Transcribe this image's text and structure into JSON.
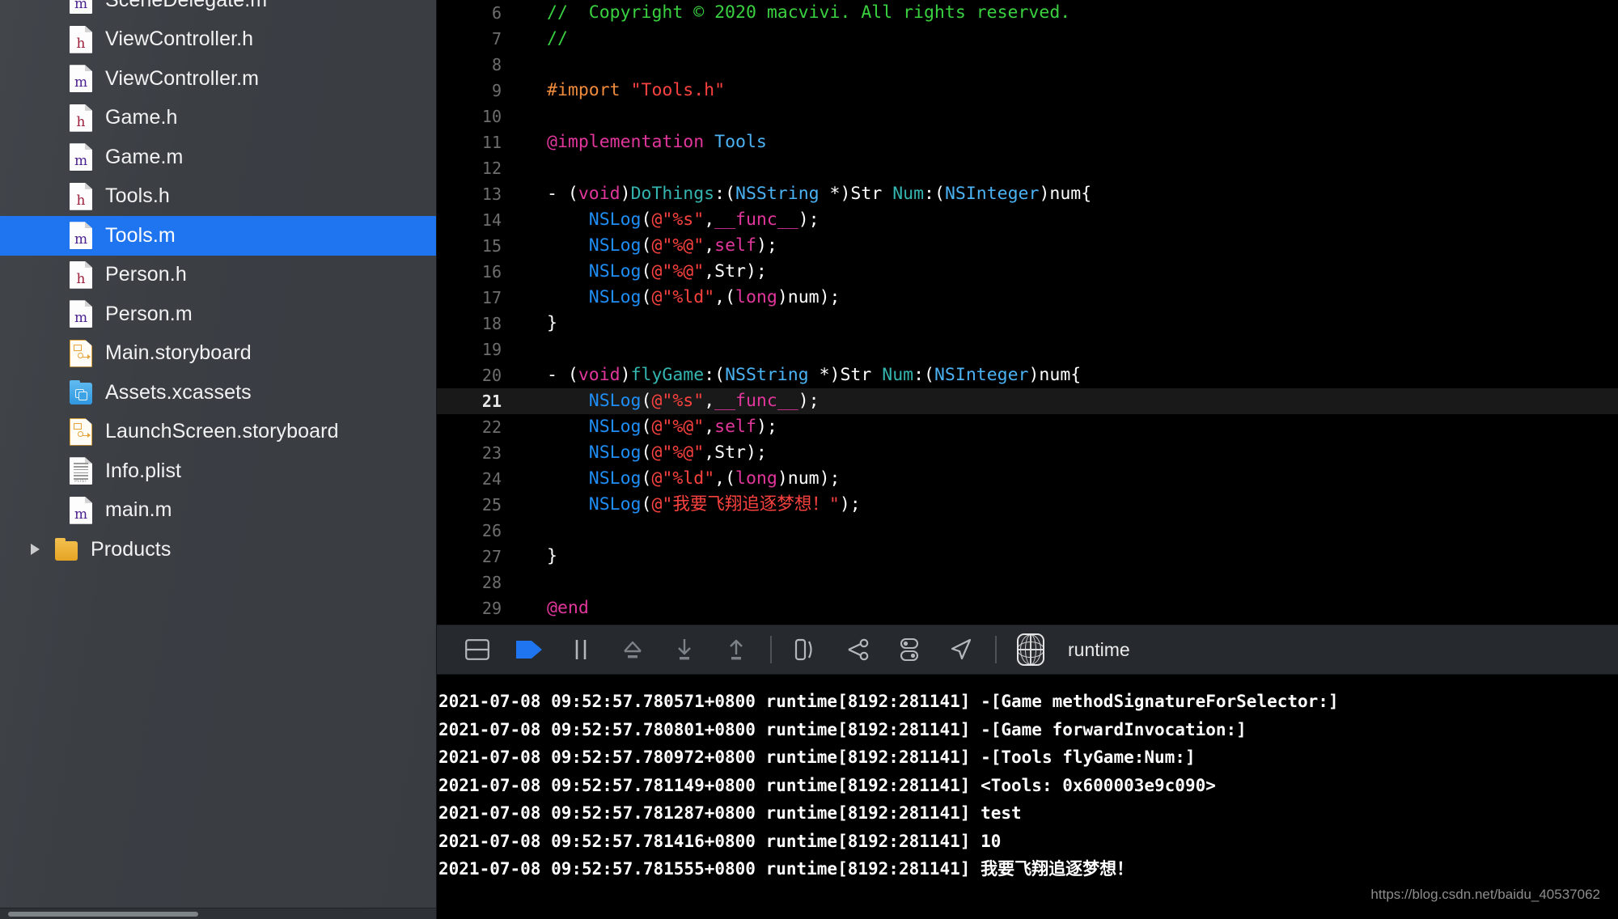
{
  "sidebar": {
    "name": "project-navigator",
    "selected_file": "Tools.m",
    "items": [
      {
        "label": "SceneDelegate.m",
        "icon": "objc-m-file-icon",
        "kind": "m",
        "selected": false,
        "partial": false
      },
      {
        "label": "ViewController.h",
        "icon": "objc-h-file-icon",
        "kind": "h",
        "selected": false,
        "partial": false
      },
      {
        "label": "ViewController.m",
        "icon": "objc-m-file-icon",
        "kind": "m",
        "selected": false,
        "partial": false
      },
      {
        "label": "Game.h",
        "icon": "objc-h-file-icon",
        "kind": "h",
        "selected": false,
        "partial": false
      },
      {
        "label": "Game.m",
        "icon": "objc-m-file-icon",
        "kind": "m",
        "selected": false,
        "partial": false
      },
      {
        "label": "Tools.h",
        "icon": "objc-h-file-icon",
        "kind": "h",
        "selected": false,
        "partial": false
      },
      {
        "label": "Tools.m",
        "icon": "objc-m-file-icon",
        "kind": "m",
        "selected": true,
        "partial": false
      },
      {
        "label": "Person.h",
        "icon": "objc-h-file-icon",
        "kind": "h",
        "selected": false,
        "partial": false
      },
      {
        "label": "Person.m",
        "icon": "objc-m-file-icon",
        "kind": "m",
        "selected": false,
        "partial": false
      },
      {
        "label": "Main.storyboard",
        "icon": "storyboard-file-icon",
        "kind": "sb",
        "selected": false,
        "partial": false
      },
      {
        "label": "Assets.xcassets",
        "icon": "xcassets-folder-icon",
        "kind": "xc",
        "selected": false,
        "partial": false
      },
      {
        "label": "LaunchScreen.storyboard",
        "icon": "storyboard-file-icon",
        "kind": "sb",
        "selected": false,
        "partial": false
      },
      {
        "label": "Info.plist",
        "icon": "plist-file-icon",
        "kind": "pl",
        "selected": false,
        "partial": false
      },
      {
        "label": "main.m",
        "icon": "objc-m-file-icon",
        "kind": "m",
        "selected": false,
        "partial": false
      },
      {
        "label": "Products",
        "icon": "folder-icon",
        "kind": "folder",
        "selected": false,
        "partial": false,
        "disclosure": true
      }
    ]
  },
  "editor": {
    "current_line": 21,
    "lines": [
      {
        "n": 6,
        "tokens": [
          {
            "t": "com",
            "s": "//  Copyright © 2020 macvivi. All rights reserved."
          }
        ]
      },
      {
        "n": 7,
        "tokens": [
          {
            "t": "com",
            "s": "//"
          }
        ]
      },
      {
        "n": 8,
        "tokens": []
      },
      {
        "n": 9,
        "tokens": [
          {
            "t": "pre",
            "s": "#import"
          },
          {
            "t": "plain",
            "s": " "
          },
          {
            "t": "str",
            "s": "\"Tools.h\""
          }
        ]
      },
      {
        "n": 10,
        "tokens": []
      },
      {
        "n": 11,
        "tokens": [
          {
            "t": "kw",
            "s": "@implementation"
          },
          {
            "t": "plain",
            "s": " "
          },
          {
            "t": "cls",
            "s": "Tools"
          }
        ]
      },
      {
        "n": 12,
        "tokens": []
      },
      {
        "n": 13,
        "tokens": [
          {
            "t": "plain",
            "s": "- ("
          },
          {
            "t": "kw",
            "s": "void"
          },
          {
            "t": "plain",
            "s": ")"
          },
          {
            "t": "meth",
            "s": "DoThings"
          },
          {
            "t": "plain",
            "s": ":("
          },
          {
            "t": "cls",
            "s": "NSString"
          },
          {
            "t": "plain",
            "s": " *)Str "
          },
          {
            "t": "meth",
            "s": "Num"
          },
          {
            "t": "plain",
            "s": ":("
          },
          {
            "t": "cls",
            "s": "NSInteger"
          },
          {
            "t": "plain",
            "s": ")num{"
          }
        ]
      },
      {
        "n": 14,
        "tokens": [
          {
            "t": "plain",
            "s": "    "
          },
          {
            "t": "fn",
            "s": "NSLog"
          },
          {
            "t": "plain",
            "s": "("
          },
          {
            "t": "str",
            "s": "@\"%s\""
          },
          {
            "t": "plain",
            "s": ","
          },
          {
            "t": "kw",
            "s": "__func__"
          },
          {
            "t": "plain",
            "s": ");"
          }
        ]
      },
      {
        "n": 15,
        "tokens": [
          {
            "t": "plain",
            "s": "    "
          },
          {
            "t": "fn",
            "s": "NSLog"
          },
          {
            "t": "plain",
            "s": "("
          },
          {
            "t": "str",
            "s": "@\"%@\""
          },
          {
            "t": "plain",
            "s": ","
          },
          {
            "t": "kw",
            "s": "self"
          },
          {
            "t": "plain",
            "s": ");"
          }
        ]
      },
      {
        "n": 16,
        "tokens": [
          {
            "t": "plain",
            "s": "    "
          },
          {
            "t": "fn",
            "s": "NSLog"
          },
          {
            "t": "plain",
            "s": "("
          },
          {
            "t": "str",
            "s": "@\"%@\""
          },
          {
            "t": "plain",
            "s": ",Str);"
          }
        ]
      },
      {
        "n": 17,
        "tokens": [
          {
            "t": "plain",
            "s": "    "
          },
          {
            "t": "fn",
            "s": "NSLog"
          },
          {
            "t": "plain",
            "s": "("
          },
          {
            "t": "str",
            "s": "@\"%ld\""
          },
          {
            "t": "plain",
            "s": ",("
          },
          {
            "t": "kw",
            "s": "long"
          },
          {
            "t": "plain",
            "s": ")num);"
          }
        ]
      },
      {
        "n": 18,
        "tokens": [
          {
            "t": "plain",
            "s": "}"
          }
        ]
      },
      {
        "n": 19,
        "tokens": []
      },
      {
        "n": 20,
        "tokens": [
          {
            "t": "plain",
            "s": "- ("
          },
          {
            "t": "kw",
            "s": "void"
          },
          {
            "t": "plain",
            "s": ")"
          },
          {
            "t": "meth",
            "s": "flyGame"
          },
          {
            "t": "plain",
            "s": ":("
          },
          {
            "t": "cls",
            "s": "NSString"
          },
          {
            "t": "plain",
            "s": " *)Str "
          },
          {
            "t": "meth",
            "s": "Num"
          },
          {
            "t": "plain",
            "s": ":("
          },
          {
            "t": "cls",
            "s": "NSInteger"
          },
          {
            "t": "plain",
            "s": ")num{"
          }
        ]
      },
      {
        "n": 21,
        "tokens": [
          {
            "t": "plain",
            "s": "    "
          },
          {
            "t": "fn",
            "s": "NSLog"
          },
          {
            "t": "plain",
            "s": "("
          },
          {
            "t": "str",
            "s": "@\"%s\""
          },
          {
            "t": "plain",
            "s": ","
          },
          {
            "t": "kw",
            "s": "__func__"
          },
          {
            "t": "plain",
            "s": ");"
          }
        ]
      },
      {
        "n": 22,
        "tokens": [
          {
            "t": "plain",
            "s": "    "
          },
          {
            "t": "fn",
            "s": "NSLog"
          },
          {
            "t": "plain",
            "s": "("
          },
          {
            "t": "str",
            "s": "@\"%@\""
          },
          {
            "t": "plain",
            "s": ","
          },
          {
            "t": "kw",
            "s": "self"
          },
          {
            "t": "plain",
            "s": ");"
          }
        ]
      },
      {
        "n": 23,
        "tokens": [
          {
            "t": "plain",
            "s": "    "
          },
          {
            "t": "fn",
            "s": "NSLog"
          },
          {
            "t": "plain",
            "s": "("
          },
          {
            "t": "str",
            "s": "@\"%@\""
          },
          {
            "t": "plain",
            "s": ",Str);"
          }
        ]
      },
      {
        "n": 24,
        "tokens": [
          {
            "t": "plain",
            "s": "    "
          },
          {
            "t": "fn",
            "s": "NSLog"
          },
          {
            "t": "plain",
            "s": "("
          },
          {
            "t": "str",
            "s": "@\"%ld\""
          },
          {
            "t": "plain",
            "s": ",("
          },
          {
            "t": "kw",
            "s": "long"
          },
          {
            "t": "plain",
            "s": ")num);"
          }
        ]
      },
      {
        "n": 25,
        "tokens": [
          {
            "t": "plain",
            "s": "    "
          },
          {
            "t": "fn",
            "s": "NSLog"
          },
          {
            "t": "plain",
            "s": "("
          },
          {
            "t": "str",
            "s": "@\"我要飞翔追逐梦想！\""
          },
          {
            "t": "plain",
            "s": ");"
          }
        ]
      },
      {
        "n": 26,
        "tokens": []
      },
      {
        "n": 27,
        "tokens": [
          {
            "t": "plain",
            "s": "}"
          }
        ]
      },
      {
        "n": 28,
        "tokens": []
      },
      {
        "n": 29,
        "tokens": [
          {
            "t": "kw",
            "s": "@end"
          }
        ]
      }
    ]
  },
  "debug_bar": {
    "scheme_label": "runtime",
    "buttons": [
      {
        "name": "hide-debug-area-button",
        "icon": "panel-toggle-icon",
        "active": false
      },
      {
        "name": "continue-button",
        "icon": "continue-arrow-icon",
        "active": true
      },
      {
        "name": "pause-button",
        "icon": "pause-icon",
        "active": false
      },
      {
        "name": "step-over-button",
        "icon": "step-over-icon",
        "active": false
      },
      {
        "name": "step-into-button",
        "icon": "step-into-icon",
        "active": false
      },
      {
        "name": "step-out-button",
        "icon": "step-out-icon",
        "active": false
      },
      {
        "name": "view-hierarchy-button",
        "icon": "view-hierarchy-icon",
        "active": false
      },
      {
        "name": "memory-graph-button",
        "icon": "memory-graph-icon",
        "active": false
      },
      {
        "name": "environment-overrides-button",
        "icon": "toggles-icon",
        "active": false
      },
      {
        "name": "simulate-location-button",
        "icon": "location-arrow-icon",
        "active": false
      }
    ]
  },
  "console": {
    "lines": [
      "2021-07-08 09:52:57.780571+0800 runtime[8192:281141] -[Game methodSignatureForSelector:]",
      "2021-07-08 09:52:57.780801+0800 runtime[8192:281141] -[Game forwardInvocation:]",
      "2021-07-08 09:52:57.780972+0800 runtime[8192:281141] -[Tools flyGame:Num:]",
      "2021-07-08 09:52:57.781149+0800 runtime[8192:281141] <Tools: 0x600003e9c090>",
      "2021-07-08 09:52:57.781287+0800 runtime[8192:281141] test",
      "2021-07-08 09:52:57.781416+0800 runtime[8192:281141] 10",
      "2021-07-08 09:52:57.781555+0800 runtime[8192:281141] 我要飞翔追逐梦想！"
    ]
  },
  "watermark": {
    "text": "https://blog.csdn.net/baidu_40537062"
  },
  "colors": {
    "selection_blue": "#1f74f0",
    "comment_green": "#3ad141",
    "string_red": "#f9423f",
    "keyword_pink": "#e1369c",
    "class_blue": "#4bb3f4",
    "method_teal": "#35b5b0",
    "function_blue": "#1f8ef6",
    "preprocessor_orange": "#ef8b3c"
  }
}
